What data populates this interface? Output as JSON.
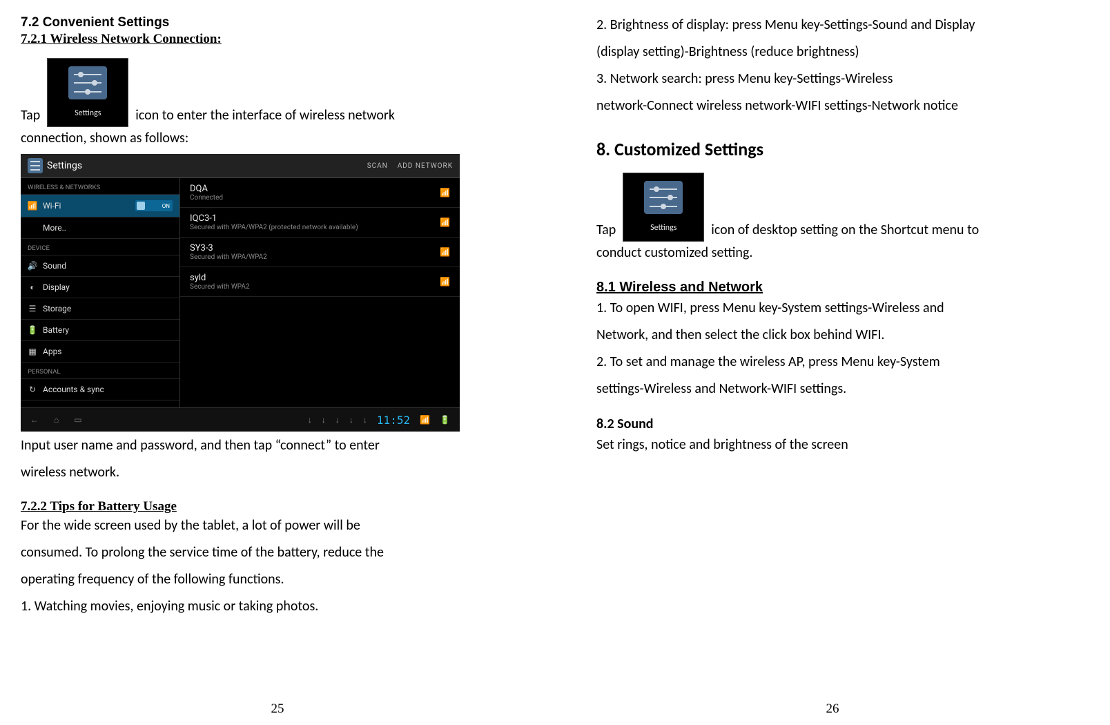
{
  "left": {
    "h72": "7.2 Convenient Settings",
    "h721": "7.2.1 Wireless Network Connection:",
    "tap_pre": "Tap",
    "tap_post": " icon to enter the interface of wireless network",
    "tap_line2": "connection, shown as follows:",
    "icon_label": "Settings",
    "shot": {
      "title": "Settings",
      "scan": "SCAN",
      "add": "ADD NETWORK",
      "grp1": "WIRELESS & NETWORKS",
      "wifi": "Wi-Fi",
      "on": "ON",
      "more": "More..",
      "grp2": "DEVICE",
      "sound": "Sound",
      "display": "Display",
      "storage": "Storage",
      "battery": "Battery",
      "apps": "Apps",
      "grp3": "PERSONAL",
      "accounts": "Accounts & sync",
      "nets": [
        {
          "name": "DQA",
          "sub": "Connected"
        },
        {
          "name": "IQC3-1",
          "sub": "Secured with WPA/WPA2 (protected network available)"
        },
        {
          "name": "SY3-3",
          "sub": "Secured with WPA/WPA2"
        },
        {
          "name": "syld",
          "sub": "Secured with WPA2"
        }
      ],
      "clock": "11:52"
    },
    "after_shot1": "Input user name and password, and then tap “connect” to enter",
    "after_shot2": "wireless network.",
    "h722": "7.2.2 Tips for Battery Usage",
    "bat1": "For the wide screen used by the tablet, a lot of power will be",
    "bat2": "consumed. To prolong the service time of the battery, reduce the",
    "bat3": "operating frequency of the following functions.",
    "bat4": "1. Watching movies, enjoying music or taking photos.",
    "page": "25"
  },
  "right": {
    "l1": "2. Brightness of display: press Menu key-Settings-Sound and Display",
    "l2": "(display setting)-Brightness (reduce brightness)",
    "l3": "3. Network search: press Menu key-Settings-Wireless",
    "l4": "network-Connect wireless network-WIFI settings-Network notice",
    "h8": "8. Customized Settings",
    "tap_pre": "Tap",
    "tap_post": " icon of desktop setting on the Shortcut menu to",
    "tap2": "conduct customized setting.",
    "icon_label": "Settings",
    "h81": "8.1 Wireless and Network",
    "w1": "1. To open WIFI, press Menu key-System settings-Wireless and",
    "w2": "Network, and then select the click box behind WIFI.",
    "w3": "2. To set and manage the wireless AP, press Menu key-System",
    "w4": "settings-Wireless and Network-WIFI settings.",
    "h82": "8.2 Sound",
    "s1": "Set rings, notice and brightness of the screen",
    "page": "26"
  }
}
